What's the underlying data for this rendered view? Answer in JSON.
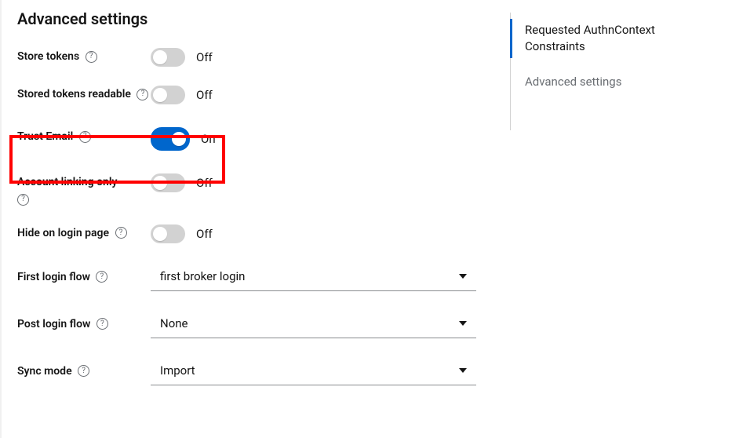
{
  "section_title": "Advanced settings",
  "toggles": {
    "store_tokens": {
      "label": "Store tokens",
      "value": "Off",
      "on": false
    },
    "stored_tokens_readable": {
      "label": "Stored tokens readable",
      "value": "Off",
      "on": false
    },
    "trust_email": {
      "label": "Trust Email",
      "value": "On",
      "on": true
    },
    "account_linking_only": {
      "label": "Account linking only",
      "value": "Off",
      "on": false
    },
    "hide_on_login_page": {
      "label": "Hide on login page",
      "value": "Off",
      "on": false
    }
  },
  "selects": {
    "first_login_flow": {
      "label": "First login flow",
      "value": "first broker login"
    },
    "post_login_flow": {
      "label": "Post login flow",
      "value": "None"
    },
    "sync_mode": {
      "label": "Sync mode",
      "value": "Import"
    }
  },
  "sidebar": {
    "items": [
      {
        "label": "Requested AuthnContext Constraints",
        "active": true
      },
      {
        "label": "Advanced settings",
        "active": false
      }
    ]
  }
}
